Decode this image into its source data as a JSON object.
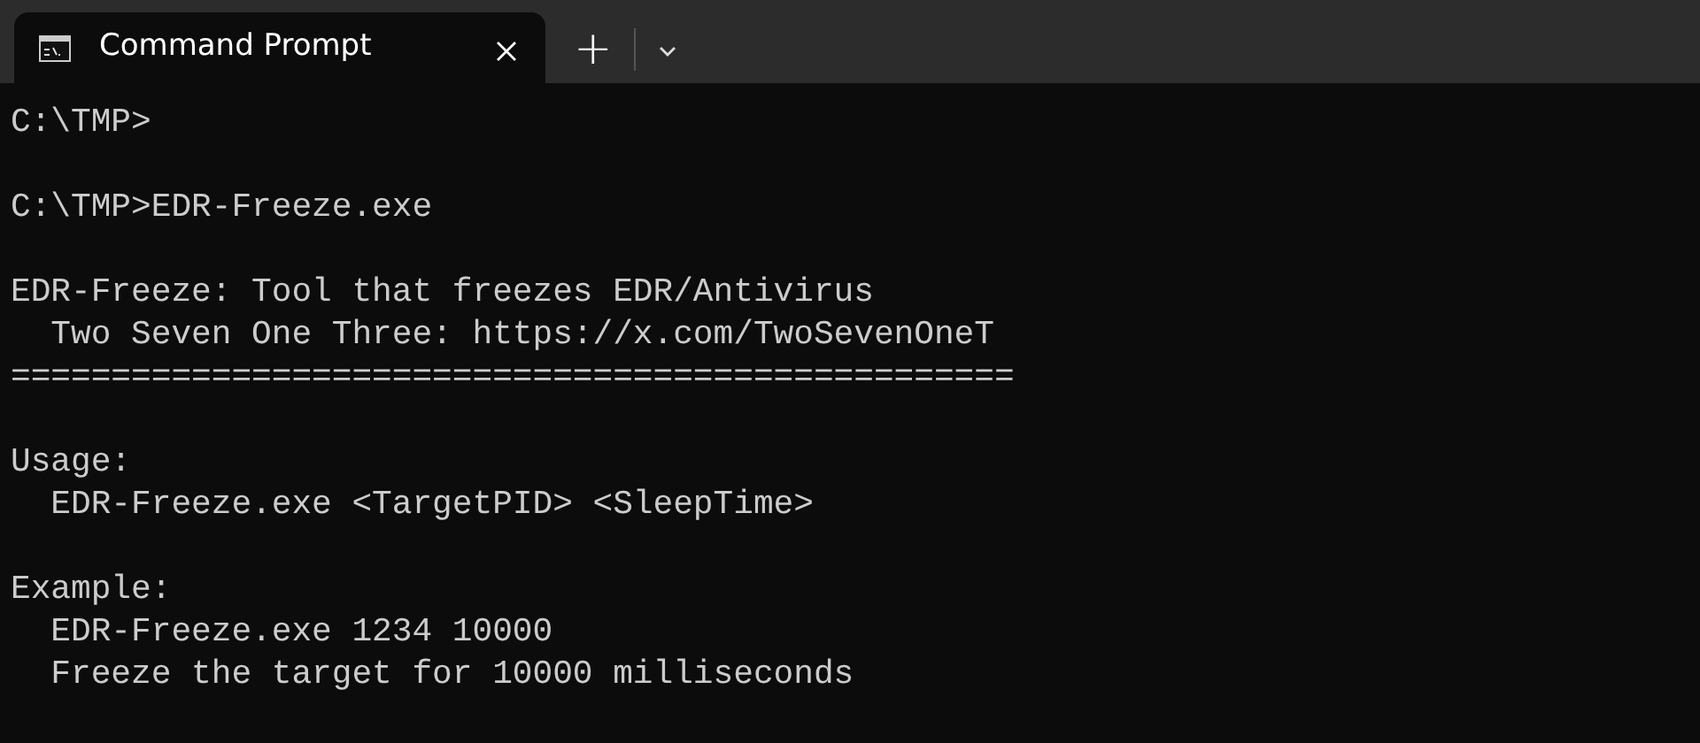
{
  "tabs": [
    {
      "title": "Command Prompt",
      "selected": true
    }
  ],
  "new_tab": "+",
  "terminal": {
    "blocks": [
      [
        "C:\\TMP>"
      ],
      [
        "C:\\TMP>EDR-Freeze.exe"
      ],
      [
        "EDR-Freeze: Tool that freezes EDR/Antivirus",
        "  Two Seven One Three: https://x.com/TwoSevenOneT",
        "=================================================="
      ],
      [
        "Usage:",
        "  EDR-Freeze.exe <TargetPID> <SleepTime>"
      ],
      [
        "Example:",
        "  EDR-Freeze.exe 1234 10000",
        "  Freeze the target for 10000 milliseconds"
      ]
    ]
  }
}
